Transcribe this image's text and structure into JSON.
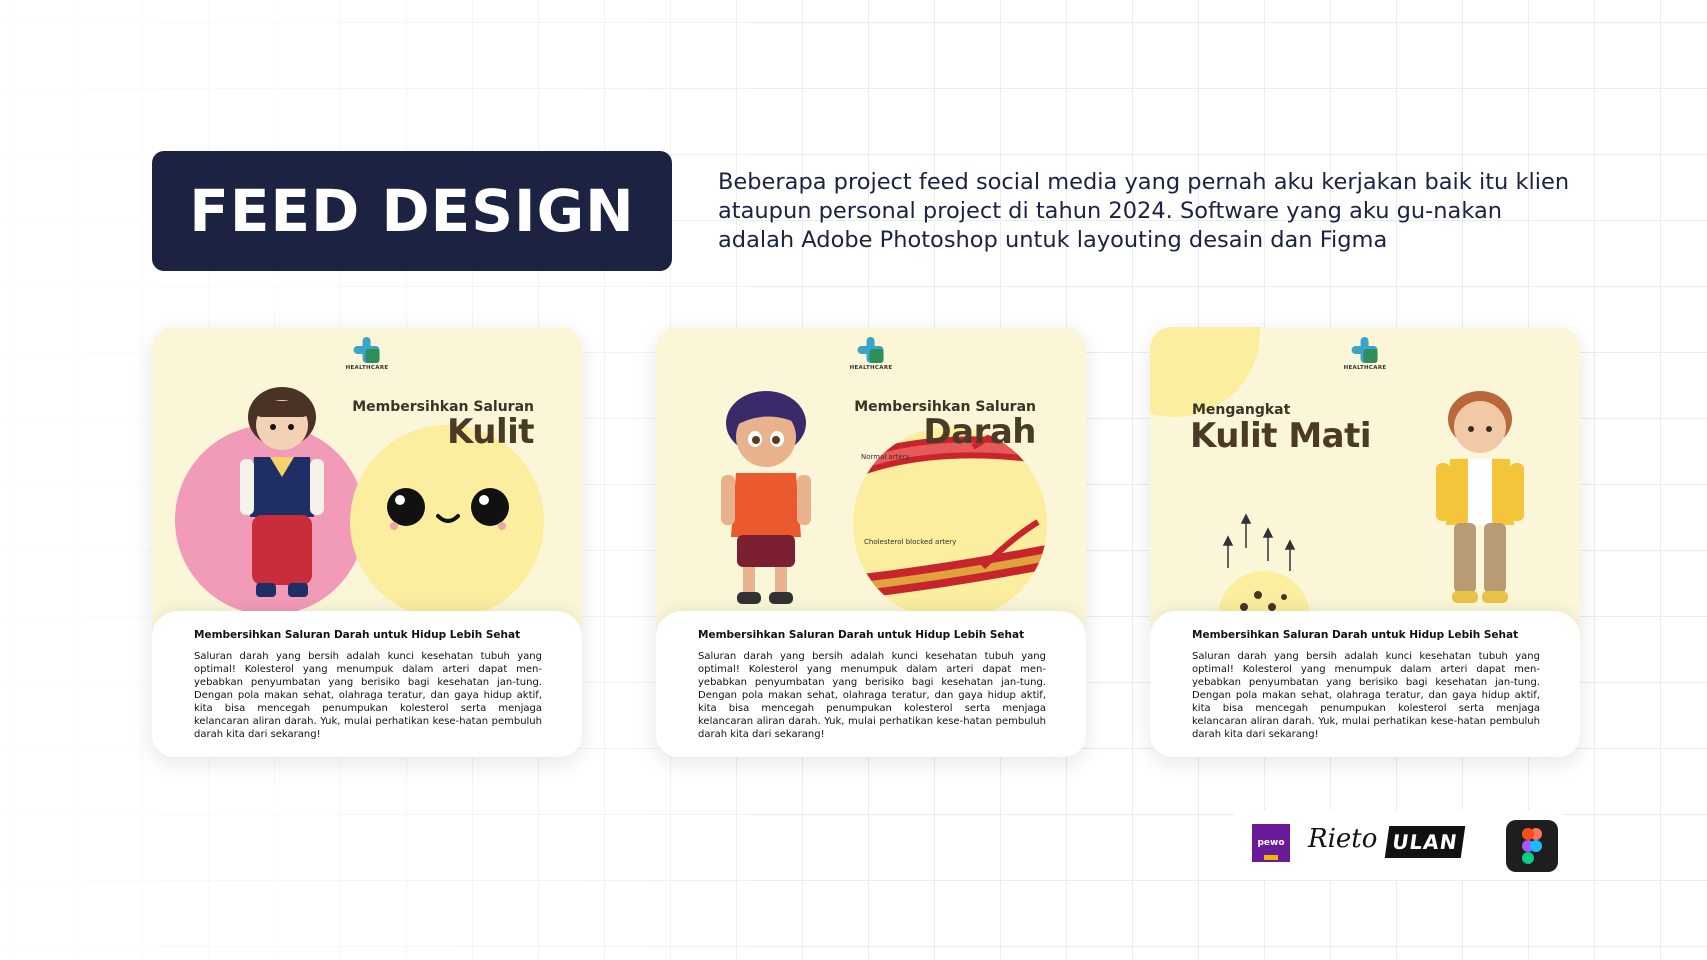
{
  "header": {
    "title": "FEED DESIGN",
    "description": "Beberapa project feed social media yang pernah aku kerjakan baik itu klien ataupun personal project di tahun 2024. Software yang aku gu-nakan adalah Adobe Photoshop untuk layouting desain dan Figma"
  },
  "cards": [
    {
      "logo_text": "HEALTHCARE",
      "subtitle": "Membersihkan Saluran",
      "title": "Kulit",
      "panel_heading": "Membersihkan Saluran Darah untuk Hidup Lebih Sehat",
      "panel_body": "Saluran darah yang bersih adalah kunci kesehatan tubuh yang optimal! Kolesterol yang menumpuk dalam arteri dapat men-yebabkan penyumbatan yang berisiko bagi kesehatan jan-tung. Dengan pola makan sehat, olahraga teratur, dan gaya hidup aktif, kita bisa mencegah penumpukan kolesterol serta menjaga kelancaran aliran darah. Yuk, mulai perhatikan kese-hatan pembuluh darah kita dari sekarang!"
    },
    {
      "logo_text": "HEALTHCARE",
      "subtitle": "Membersihkan Saluran",
      "title": "Darah",
      "label_normal": "Normal artery",
      "label_blocked": "Cholesterol blocked artery",
      "panel_heading": "Membersihkan Saluran Darah untuk Hidup Lebih Sehat",
      "panel_body": "Saluran darah yang bersih adalah kunci kesehatan tubuh yang optimal! Kolesterol yang menumpuk dalam arteri dapat men-yebabkan penyumbatan yang berisiko bagi kesehatan jan-tung. Dengan pola makan sehat, olahraga teratur, dan gaya hidup aktif, kita bisa mencegah penumpukan kolesterol serta menjaga kelancaran aliran darah. Yuk, mulai perhatikan kese-hatan pembuluh darah kita dari sekarang!"
    },
    {
      "logo_text": "HEALTHCARE",
      "subtitle": "Mengangkat",
      "title": "Kulit Mati",
      "panel_heading": "Membersihkan Saluran Darah untuk Hidup Lebih Sehat",
      "panel_body": "Saluran darah yang bersih adalah kunci kesehatan tubuh yang optimal! Kolesterol yang menumpuk dalam arteri dapat men-yebabkan penyumbatan yang berisiko bagi kesehatan jan-tung. Dengan pola makan sehat, olahraga teratur, dan gaya hidup aktif, kita bisa mencegah penumpukan kolesterol serta menjaga kelancaran aliran darah. Yuk, mulai perhatikan kese-hatan pembuluh darah kita dari sekarang!"
    }
  ],
  "tools": {
    "purple_logo_text": "pewo",
    "dark_logo_text": "ULAN",
    "signature_text": "Rieto",
    "icons": [
      "pewo-logo-icon",
      "signature-logo-icon",
      "ulan-logo-icon",
      "figma-icon"
    ]
  },
  "colors": {
    "title_bg": "#1c2242",
    "card_bg": "#fcf6d8",
    "pink_circle": "#f29bb8",
    "yellow_circle": "#fbee9f",
    "heading_brown": "#4a3a26",
    "artery_red": "#c8242c"
  }
}
